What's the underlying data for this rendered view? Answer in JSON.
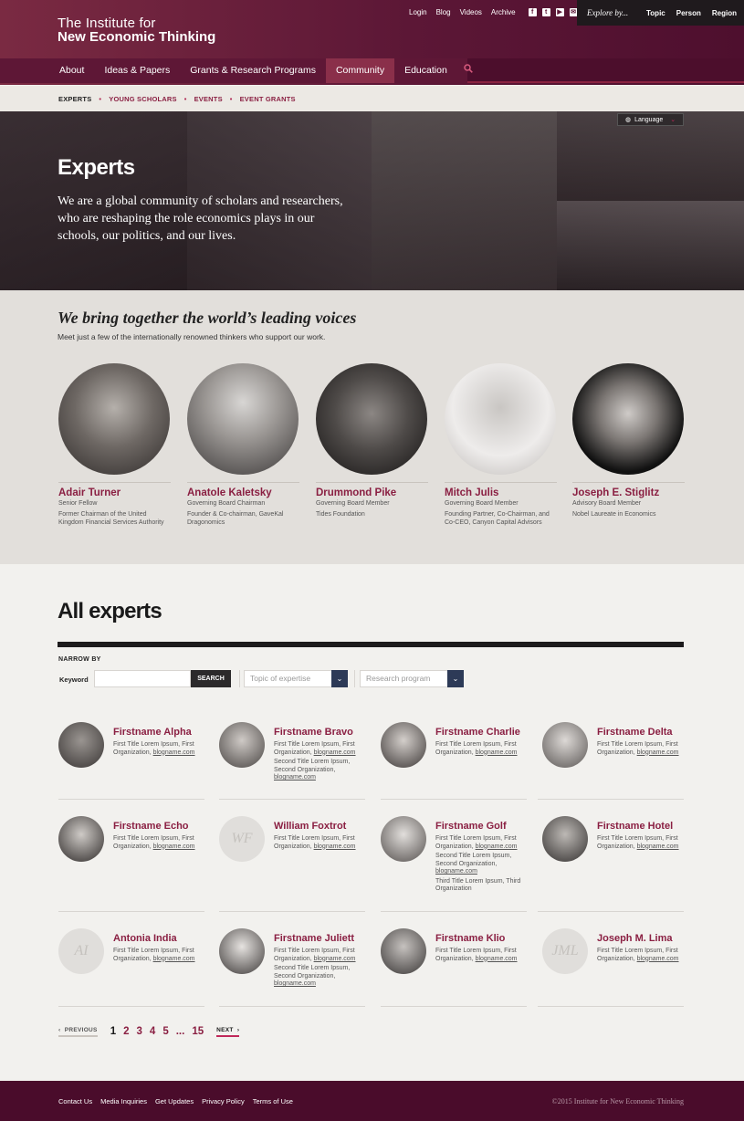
{
  "header": {
    "logo_line1": "The Institute for",
    "logo_line2": "New Economic Thinking",
    "util_links": [
      "Login",
      "Blog",
      "Videos",
      "Archive"
    ],
    "social_icons": [
      "facebook-icon",
      "twitter-icon",
      "youtube-icon",
      "email-icon"
    ],
    "explore_label": "Explore by...",
    "explore_items": [
      "Topic",
      "Person",
      "Region"
    ]
  },
  "nav": {
    "items": [
      "About",
      "Ideas & Papers",
      "Grants & Research Programs",
      "Community",
      "Education"
    ],
    "active": "Community",
    "search_icon": "search-icon"
  },
  "subnav": {
    "items": [
      "EXPERTS",
      "YOUNG SCHOLARS",
      "EVENTS",
      "EVENT GRANTS"
    ]
  },
  "hero": {
    "language_label": "Language",
    "title": "Experts",
    "intro": "We are a global community of scholars and researchers, who are reshaping the role economics plays in our schools, our politics, and our lives."
  },
  "featured": {
    "heading": "We bring together the world’s leading voices",
    "subheading": "Meet just a few of the internationally renowned thinkers who support our work.",
    "people": [
      {
        "name": "Adair Turner",
        "role": "Senior Fellow",
        "desc": "Former Chairman of the United Kingdom Financial Services Authority"
      },
      {
        "name": "Anatole Kaletsky",
        "role": "Governing Board Chairman",
        "desc": "Founder & Co-chairman, GaveKal Dragonomics"
      },
      {
        "name": "Drummond Pike",
        "role": "Governing Board Member",
        "desc": "Tides Foundation"
      },
      {
        "name": "Mitch Julis",
        "role": "Governing Board Member",
        "desc": "Founding Partner, Co-Chairman, and Co-CEO, Canyon Capital Advisors"
      },
      {
        "name": "Joseph E. Stiglitz",
        "role": "Advisory Board Member",
        "desc": "Nobel Laureate in Economics"
      }
    ]
  },
  "all": {
    "heading": "All experts",
    "narrow_by": "NARROW BY",
    "keyword_label": "Keyword",
    "keyword_value": "",
    "search_button": "SEARCH",
    "topic_placeholder": "Topic of expertise",
    "program_placeholder": "Research program",
    "experts": [
      {
        "name": "Firstname Alpha",
        "initials": "",
        "lines": [
          "First Title Lorem Ipsum, First Organization, "
        ],
        "link": "blogname.com",
        "extra": []
      },
      {
        "name": "Firstname Bravo",
        "initials": "",
        "lines": [
          "First Title Lorem Ipsum, First Organization, "
        ],
        "link": "blogname.com",
        "extra": [
          "Second Title Lorem Ipsum, Second Organization,"
        ],
        "extra_link": "blogname.com"
      },
      {
        "name": "Firstname Charlie",
        "initials": "",
        "lines": [
          "First Title Lorem Ipsum, First Organization, "
        ],
        "link": "blogname.com",
        "extra": []
      },
      {
        "name": "Firstname Delta",
        "initials": "",
        "lines": [
          "First Title Lorem Ipsum, First Organization,"
        ],
        "link": "blogname.com",
        "extra": []
      },
      {
        "name": "Firstname Echo",
        "initials": "",
        "lines": [
          "First Title Lorem Ipsum, First Organization, "
        ],
        "link": "blogname.com",
        "extra": []
      },
      {
        "name": "William Foxtrot",
        "initials": "WF",
        "lines": [
          "First Title Lorem Ipsum, First Organization, "
        ],
        "link": "blogname.com",
        "extra": []
      },
      {
        "name": "Firstname Golf",
        "initials": "",
        "lines": [
          "First Title Lorem Ipsum, First Organization, "
        ],
        "link": "blogname.com",
        "extra": [
          "Second Title Lorem Ipsum, Second Organization,"
        ],
        "extra_link": "blogname.com",
        "extra2": "Third Title Lorem Ipsum, Third Organization"
      },
      {
        "name": "Firstname Hotel",
        "initials": "",
        "lines": [
          "First Title Lorem Ipsum, First Organization,"
        ],
        "link": "blogname.com",
        "extra": []
      },
      {
        "name": "Antonia India",
        "initials": "AI",
        "lines": [
          "First Title Lorem Ipsum, First Organization, "
        ],
        "link": "blogname.com",
        "extra": []
      },
      {
        "name": "Firstname Juliett",
        "initials": "",
        "lines": [
          "First Title Lorem Ipsum, First Organization, "
        ],
        "link": "blogname.com",
        "extra": [
          "Second Title Lorem Ipsum, Second Organization,"
        ],
        "extra_link": "blogname.com"
      },
      {
        "name": "Firstname Klio",
        "initials": "",
        "lines": [
          "First Title Lorem Ipsum, First Organization, "
        ],
        "link": "blogname.com",
        "extra": []
      },
      {
        "name": "Joseph M. Lima",
        "initials": "JML",
        "lines": [
          "First Title Lorem Ipsum, First Organization,"
        ],
        "link": "blogname.com",
        "extra": []
      }
    ]
  },
  "pager": {
    "prev": "PREVIOUS",
    "pages": [
      "1",
      "2",
      "3",
      "4",
      "5",
      "...",
      "15"
    ],
    "current": "1",
    "next": "NEXT"
  },
  "footer": {
    "links": [
      "Contact Us",
      "Media Inquiries",
      "Get Updates",
      "Privacy Policy",
      "Terms of Use"
    ],
    "copyright": "©2015 Institute for New Economic Thinking"
  },
  "colors": {
    "brand": "#5c1736",
    "accent": "#8a1f42",
    "footer": "#4a0c2b"
  }
}
